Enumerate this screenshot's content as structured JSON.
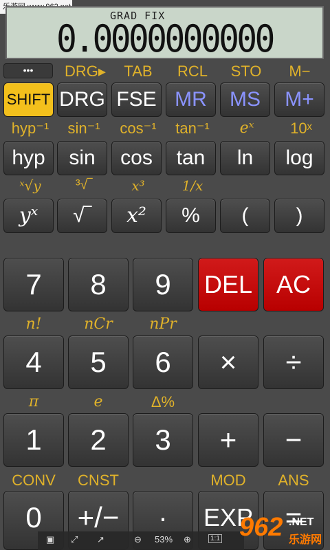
{
  "watermark": "乐游网 www.962.net",
  "display": {
    "mode": "GRAD FIX",
    "value": "0.0000000000"
  },
  "menu_button": "•••",
  "row1_labels": [
    "DRG▸",
    "TAB",
    "RCL",
    "STO",
    "M−"
  ],
  "row1_keys": [
    "SHIFT",
    "DRG",
    "FSE",
    "MR",
    "MS",
    "M+"
  ],
  "row2_labels": [
    "hyp⁻¹",
    "sin⁻¹",
    "cos⁻¹",
    "tan⁻¹",
    "eˣ",
    "10ˣ"
  ],
  "row2_keys": [
    "hyp",
    "sin",
    "cos",
    "tan",
    "ln",
    "log"
  ],
  "row3_labels": [
    "ˣ√y",
    "³√‾",
    "x³",
    "1/x"
  ],
  "row3_keys": [
    "yˣ",
    "√‾",
    "x²",
    "%",
    "(",
    ")"
  ],
  "numpad": {
    "row1": [
      "7",
      "8",
      "9",
      "DEL",
      "AC"
    ],
    "row2_labels": [
      "n!",
      "nCr",
      "nPr"
    ],
    "row2": [
      "4",
      "5",
      "6",
      "×",
      "÷"
    ],
    "row3_labels": [
      "π",
      "e",
      "Δ%"
    ],
    "row3": [
      "1",
      "2",
      "3",
      "+",
      "−"
    ],
    "row4_labels": [
      "CONV",
      "CNST",
      "MOD",
      "ANS"
    ],
    "row4": [
      "0",
      "+/−",
      "·",
      "EXP",
      "="
    ]
  },
  "bottombar": {
    "zoom": "53%",
    "fit": "1:1"
  },
  "logo": {
    "num": "962",
    "txt": ".NET",
    "cn": "乐游网"
  },
  "colors": {
    "accent": "#e0b22a",
    "shift": "#f3c01c",
    "red": "#c40000",
    "memory": "#8a93ff",
    "lcd": "#c9d6c9"
  }
}
